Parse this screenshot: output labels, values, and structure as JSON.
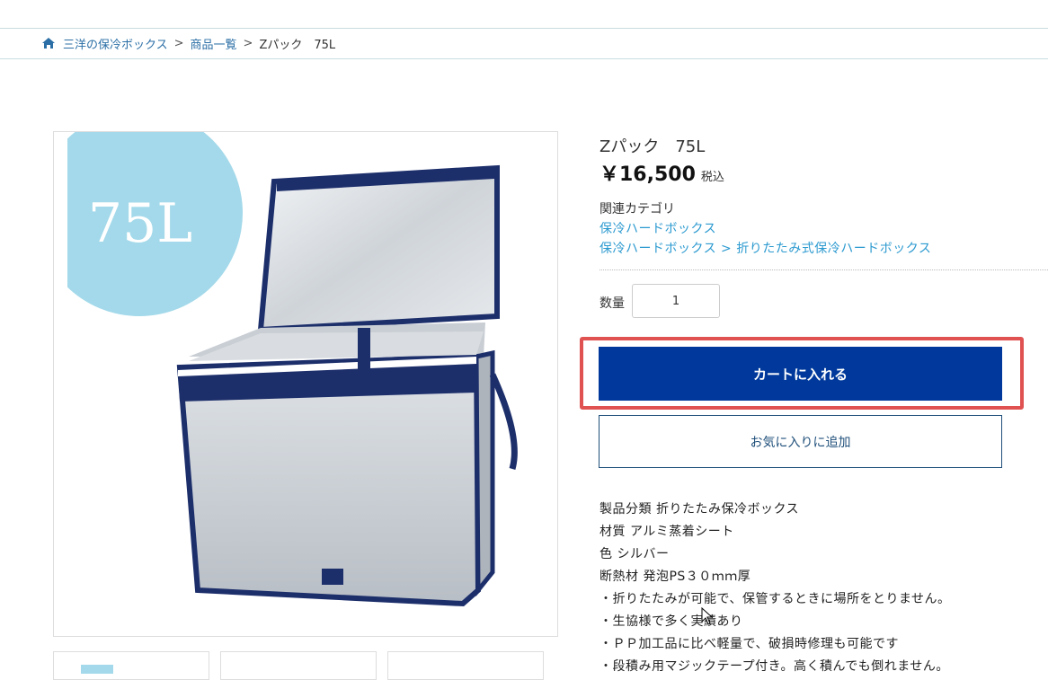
{
  "breadcrumb": {
    "home": "三洋の保冷ボックス",
    "list": "商品一覧",
    "current": "Zパック　75L",
    "separator": ">"
  },
  "product": {
    "image_badge": "75L",
    "title": "Zパック　75L",
    "price": "￥16,500",
    "tax_label": "税込",
    "category_label": "関連カテゴリ",
    "category_1": "保冷ハードボックス",
    "category_2_parent": "保冷ハードボックス",
    "category_2_sep": ">",
    "category_2_child": "折りたたみ式保冷ハードボックス",
    "qty_label": "数量",
    "qty_value": "1",
    "cart_button": "カートに入れる",
    "fav_button": "お気に入りに追加"
  },
  "description": [
    "製品分類 折りたたみ保冷ボックス",
    "材質 アルミ蒸着シート",
    "色 シルバー",
    "断熱材 発泡PS３０ｍｍ厚",
    "・折りたたみが可能で、保管するときに場所をとりません。",
    "・生協様で多く実績あり",
    "・ＰＰ加工品に比べ軽量で、破損時修理も可能です",
    "・段積み用マジックテープ付き。高く積んでも倒れません。"
  ],
  "colors": {
    "link": "#2c9ad0",
    "breadcrumb_link": "#2c6fa6",
    "cart_bg": "#00399b",
    "highlight": "#e05252",
    "badge": "#a3d9ea"
  },
  "icons": [
    "home-icon",
    "mouse-cursor-icon"
  ]
}
